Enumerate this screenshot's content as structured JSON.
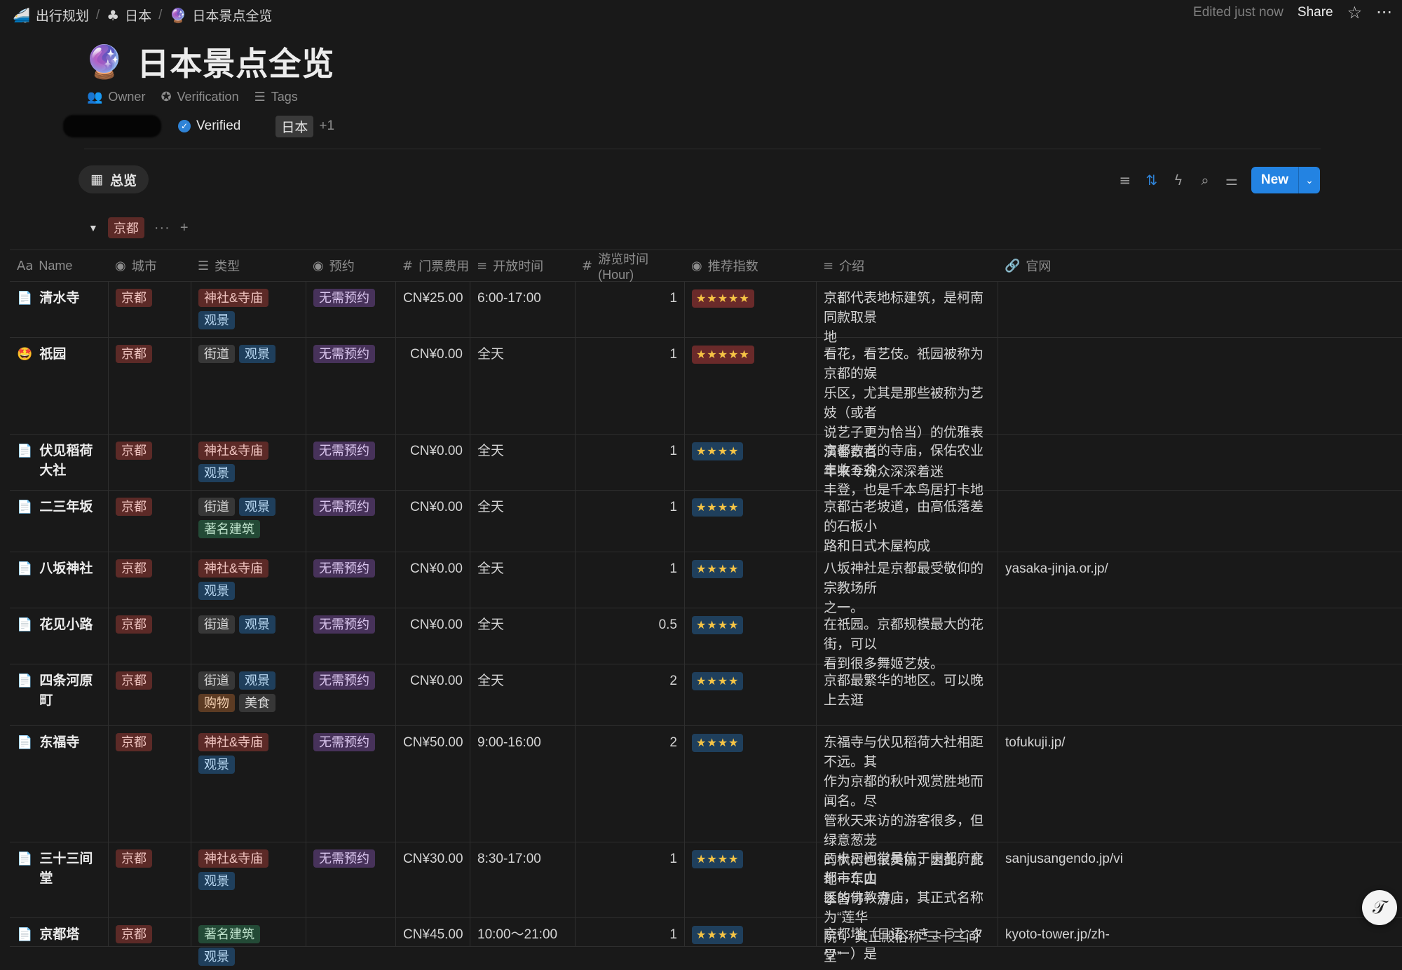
{
  "breadcrumb": [
    {
      "icon": "🚄",
      "label": "出行规划"
    },
    {
      "icon": "♣",
      "label": "日本"
    },
    {
      "icon": "🔮",
      "label": "日本景点全览"
    }
  ],
  "topbar": {
    "edited": "Edited just now",
    "share": "Share",
    "star": "☆",
    "more": "···"
  },
  "page": {
    "emoji": "🔮",
    "title": "日本景点全览"
  },
  "properties": {
    "owner_label": "Owner",
    "verification_label": "Verification",
    "tags_label": "Tags",
    "verified_value": "Verified",
    "tag_value": "日本",
    "tag_more": "+1"
  },
  "view": {
    "tab": "总览",
    "new_label": "New"
  },
  "group": {
    "label": "京都",
    "more": "···",
    "add": "+"
  },
  "columns": [
    "Name",
    "城市",
    "类型",
    "预约",
    "门票费用",
    "开放时间",
    "游览时间(Hour)",
    "推荐指数",
    "介绍",
    "官网"
  ],
  "rows": [
    {
      "icon": "📄",
      "name": "清水寺",
      "city": "京都",
      "types": [
        [
          "神社&寺庙",
          "red"
        ],
        [
          "观景",
          "blue"
        ]
      ],
      "reserve": "无需预约",
      "fee": "CN¥25.00",
      "hours": "6:00-17:00",
      "duration": "1",
      "stars": "★★★★★",
      "star_level": 5,
      "intro": "京都代表地标建筑，是柯南同款取景\n地",
      "site": ""
    },
    {
      "icon": "🤩",
      "name": "祇园",
      "city": "京都",
      "types": [
        [
          "街道",
          "gray"
        ],
        [
          "观景",
          "blue"
        ]
      ],
      "reserve": "无需预约",
      "fee": "CN¥0.00",
      "hours": "全天",
      "duration": "1",
      "stars": "★★★★★",
      "star_level": 5,
      "intro": "看花，看艺伎。祇园被称为京都的娱\n乐区，尤其是那些被称为艺妓（或者\n说艺子更为恰当）的优雅表演者数百\n年来令观众深深着迷",
      "site": ""
    },
    {
      "icon": "📄",
      "name": "伏见稻荷大社",
      "city": "京都",
      "types": [
        [
          "神社&寺庙",
          "red"
        ],
        [
          "观景",
          "blue"
        ]
      ],
      "reserve": "无需预约",
      "fee": "CN¥0.00",
      "hours": "全天",
      "duration": "1",
      "stars": "★★★★",
      "star_level": 4,
      "intro": "京都古老的寺庙，保佑农业丰收五谷\n丰登，也是千本鸟居打卡地",
      "site": ""
    },
    {
      "icon": "📄",
      "name": "二三年坂",
      "city": "京都",
      "types": [
        [
          "街道",
          "gray"
        ],
        [
          "观景",
          "blue"
        ],
        [
          "著名建筑",
          "green"
        ]
      ],
      "reserve": "无需预约",
      "fee": "CN¥0.00",
      "hours": "全天",
      "duration": "1",
      "stars": "★★★★",
      "star_level": 4,
      "intro": "京都古老坡道，由高低落差的石板小\n路和日式木屋构成",
      "site": ""
    },
    {
      "icon": "📄",
      "name": "八坂神社",
      "city": "京都",
      "types": [
        [
          "神社&寺庙",
          "red"
        ],
        [
          "观景",
          "blue"
        ]
      ],
      "reserve": "无需预约",
      "fee": "CN¥0.00",
      "hours": "全天",
      "duration": "1",
      "stars": "★★★★",
      "star_level": 4,
      "intro": "八坂神社是京都最受敬仰的宗教场所\n之一。",
      "site": "yasaka-jinja.or.jp/"
    },
    {
      "icon": "📄",
      "name": "花见小路",
      "city": "京都",
      "types": [
        [
          "街道",
          "gray"
        ],
        [
          "观景",
          "blue"
        ]
      ],
      "reserve": "无需预约",
      "fee": "CN¥0.00",
      "hours": "全天",
      "duration": "0.5",
      "stars": "★★★★",
      "star_level": 4,
      "intro": "在祇园。京都规模最大的花街，可以\n看到很多舞姬艺妓。",
      "site": ""
    },
    {
      "icon": "📄",
      "name": "四条河原町",
      "city": "京都",
      "types": [
        [
          "街道",
          "gray"
        ],
        [
          "观景",
          "blue"
        ],
        [
          "购物",
          "orange"
        ],
        [
          "美食",
          "gray"
        ]
      ],
      "reserve": "无需预约",
      "fee": "CN¥0.00",
      "hours": "全天",
      "duration": "2",
      "stars": "★★★★",
      "star_level": 4,
      "intro": "京都最繁华的地区。可以晚上去逛",
      "site": ""
    },
    {
      "icon": "📄",
      "name": "东福寺",
      "city": "京都",
      "types": [
        [
          "神社&寺庙",
          "red"
        ],
        [
          "观景",
          "blue"
        ]
      ],
      "reserve": "无需预约",
      "fee": "CN¥50.00",
      "hours": "9:00-16:00",
      "duration": "2",
      "stars": "★★★★",
      "star_level": 4,
      "intro": "东福寺与伏见稻荷大社相距不远。其\n作为京都的秋叶观赏胜地而闻名。尽\n管秋天来访的游客很多，但绿意葱茏\n的枫树也很美丽，因此，此地一年四\n季皆可一游。",
      "site": "tofukuji.jp/"
    },
    {
      "icon": "📄",
      "name": "三十三间堂",
      "city": "京都",
      "types": [
        [
          "神社&寺庙",
          "red"
        ],
        [
          "观景",
          "blue"
        ]
      ],
      "reserve": "无需预约",
      "fee": "CN¥30.00",
      "hours": "8:30-17:00",
      "duration": "1",
      "stars": "★★★★",
      "star_level": 4,
      "intro": "三十三间堂是位于京都府京都市东山\n区的佛教寺庙，其正式名称为“莲华\n院”，其正殿俗称“三十三间堂”",
      "site": "sanjusangendo.jp/vi"
    },
    {
      "icon": "📄",
      "name": "京都塔",
      "city": "京都",
      "types": [
        [
          "著名建筑",
          "green"
        ],
        [
          "观景",
          "blue"
        ]
      ],
      "reserve": "",
      "fee": "CN¥45.00",
      "hours": "10:00～21:00",
      "duration": "1",
      "stars": "★★★★",
      "star_level": 4,
      "intro": "京都塔（日语：きょうとタワー）是",
      "site": "kyoto-tower.jp/zh-"
    }
  ],
  "fab_icon": "𝒯"
}
